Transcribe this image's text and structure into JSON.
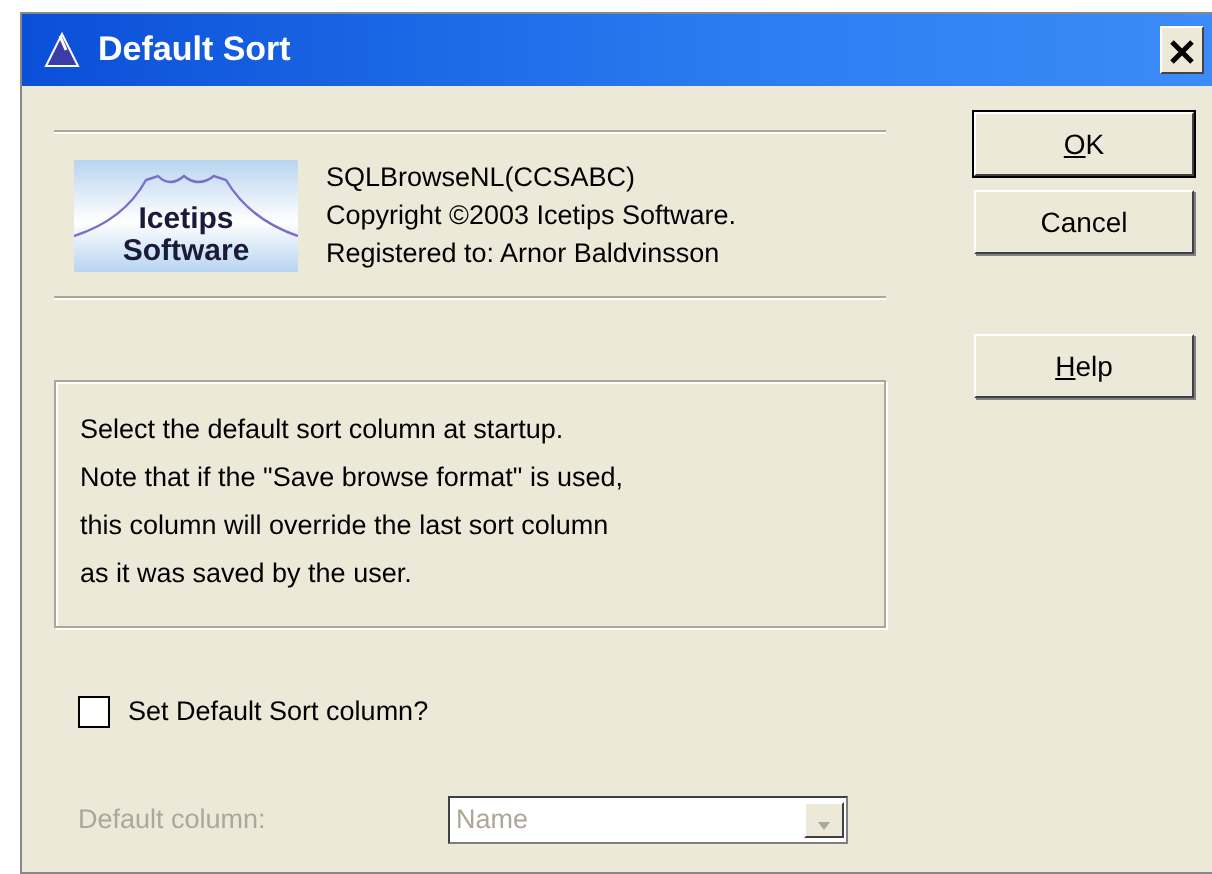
{
  "window": {
    "title": "Default Sort"
  },
  "about": {
    "product": "SQLBrowseNL(CCSABC)",
    "copyright": "Copyright ©2003 Icetips Software.",
    "registered": "Registered to: Arnor Baldvinsson",
    "logo_lines": [
      "Icetips",
      "Software"
    ]
  },
  "info_text": [
    "Select the default sort column at startup.",
    "Note that if the \"Save browse format\" is used,",
    "this column will override the last sort column",
    "as it was saved by the user."
  ],
  "checkbox": {
    "label": "Set Default Sort column?",
    "checked": false
  },
  "default_column": {
    "label": "Default column:",
    "value": "Name",
    "disabled": true
  },
  "buttons": [
    {
      "label": "OK",
      "default": true,
      "underline_first": true
    },
    {
      "label": "Cancel",
      "default": false,
      "underline_first": false
    },
    {
      "label": "Help",
      "default": false,
      "underline_first": true
    }
  ]
}
